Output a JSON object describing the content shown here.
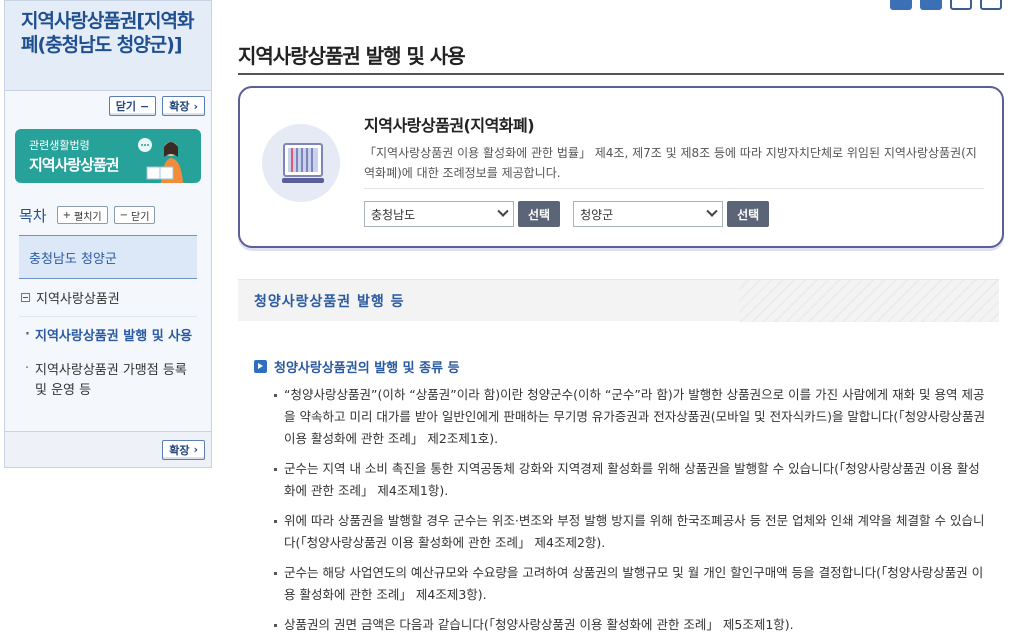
{
  "sidebar": {
    "title": "지역사랑상품권[지역화폐(충청남도 청양군)]",
    "close_label": "닫기",
    "expand_label": "확장",
    "banner": {
      "small": "관련생활법령",
      "big": "지역사랑상품권",
      "color": "#26a29a"
    },
    "toc": {
      "label": "목차",
      "expand_all": "펼치기",
      "collapse_all": "닫기",
      "region": "충청남도 청양군",
      "category": "지역사랑상품권",
      "items": [
        {
          "label": "지역사랑상품권 발행 및 사용",
          "active": true
        },
        {
          "label": "지역사랑상품권 가맹점 등록 및 운영 등",
          "active": false
        }
      ]
    },
    "footer_expand_label": "확장"
  },
  "main": {
    "page_title": "지역사랑상품권 발행 및 사용",
    "toolbar_icons": [
      "share-icon",
      "share-nodes-icon",
      "print-icon",
      "download-icon"
    ],
    "info": {
      "title": "지역사랑상품권(지역화폐)",
      "desc": "「지역사랑상품권 이용 활성화에 관한 법률」 제4조, 제7조 및 제8조 등에 따라 지방자치단체로 위임된 지역사랑상품권(지역화폐)에 대한 조례정보를 제공합니다.",
      "province_select": "충청남도",
      "city_select": "청양군",
      "select_button": "선택"
    },
    "section_title": "청양사랑상품권 발행 등",
    "subsection_title": "청양사랑상품권의 발행 및 종류 등",
    "paragraphs": [
      "“청양사랑상품권”(이하 “상품권”이라 함)이란 청양군수(이하 “군수”라 함)가 발행한 상품권으로 이를 가진 사람에게 재화 및 용역 제공을 약속하고 미리 대가를 받아 일반인에게 판매하는 무기명 유가증권과 전자상품권(모바일 및 전자식카드)을 말합니다(「청양사랑상품권 이용 활성화에 관한 조례」 제2조제1호).",
      "군수는 지역 내 소비 촉진을 통한 지역공동체 강화와 지역경제 활성화를 위해 상품권을 발행할 수 있습니다(「청양사랑상품권 이용 활성화에 관한 조례」 제4조제1항).",
      "위에 따라 상품권을 발행할 경우 군수는 위조·변조와 부정 발행 방지를 위해 한국조폐공사 등 전문 업체와 인쇄 계약을 체결할 수 있습니다(「청양사랑상품권 이용 활성화에 관한 조례」 제4조제2항).",
      "군수는 해당 사업연도의 예산규모와 수요량을 고려하여 상품권의 발행규모 및 월 개인 할인구매액 등을 결정합니다(「청양사랑상품권 이용 활성화에 관한 조례」 제4조제3항).",
      "상품권의 권면 금액은 다음과 같습니다(「청양사랑상품권 이용 활성화에 관한 조례」 제5조제1항)."
    ]
  }
}
